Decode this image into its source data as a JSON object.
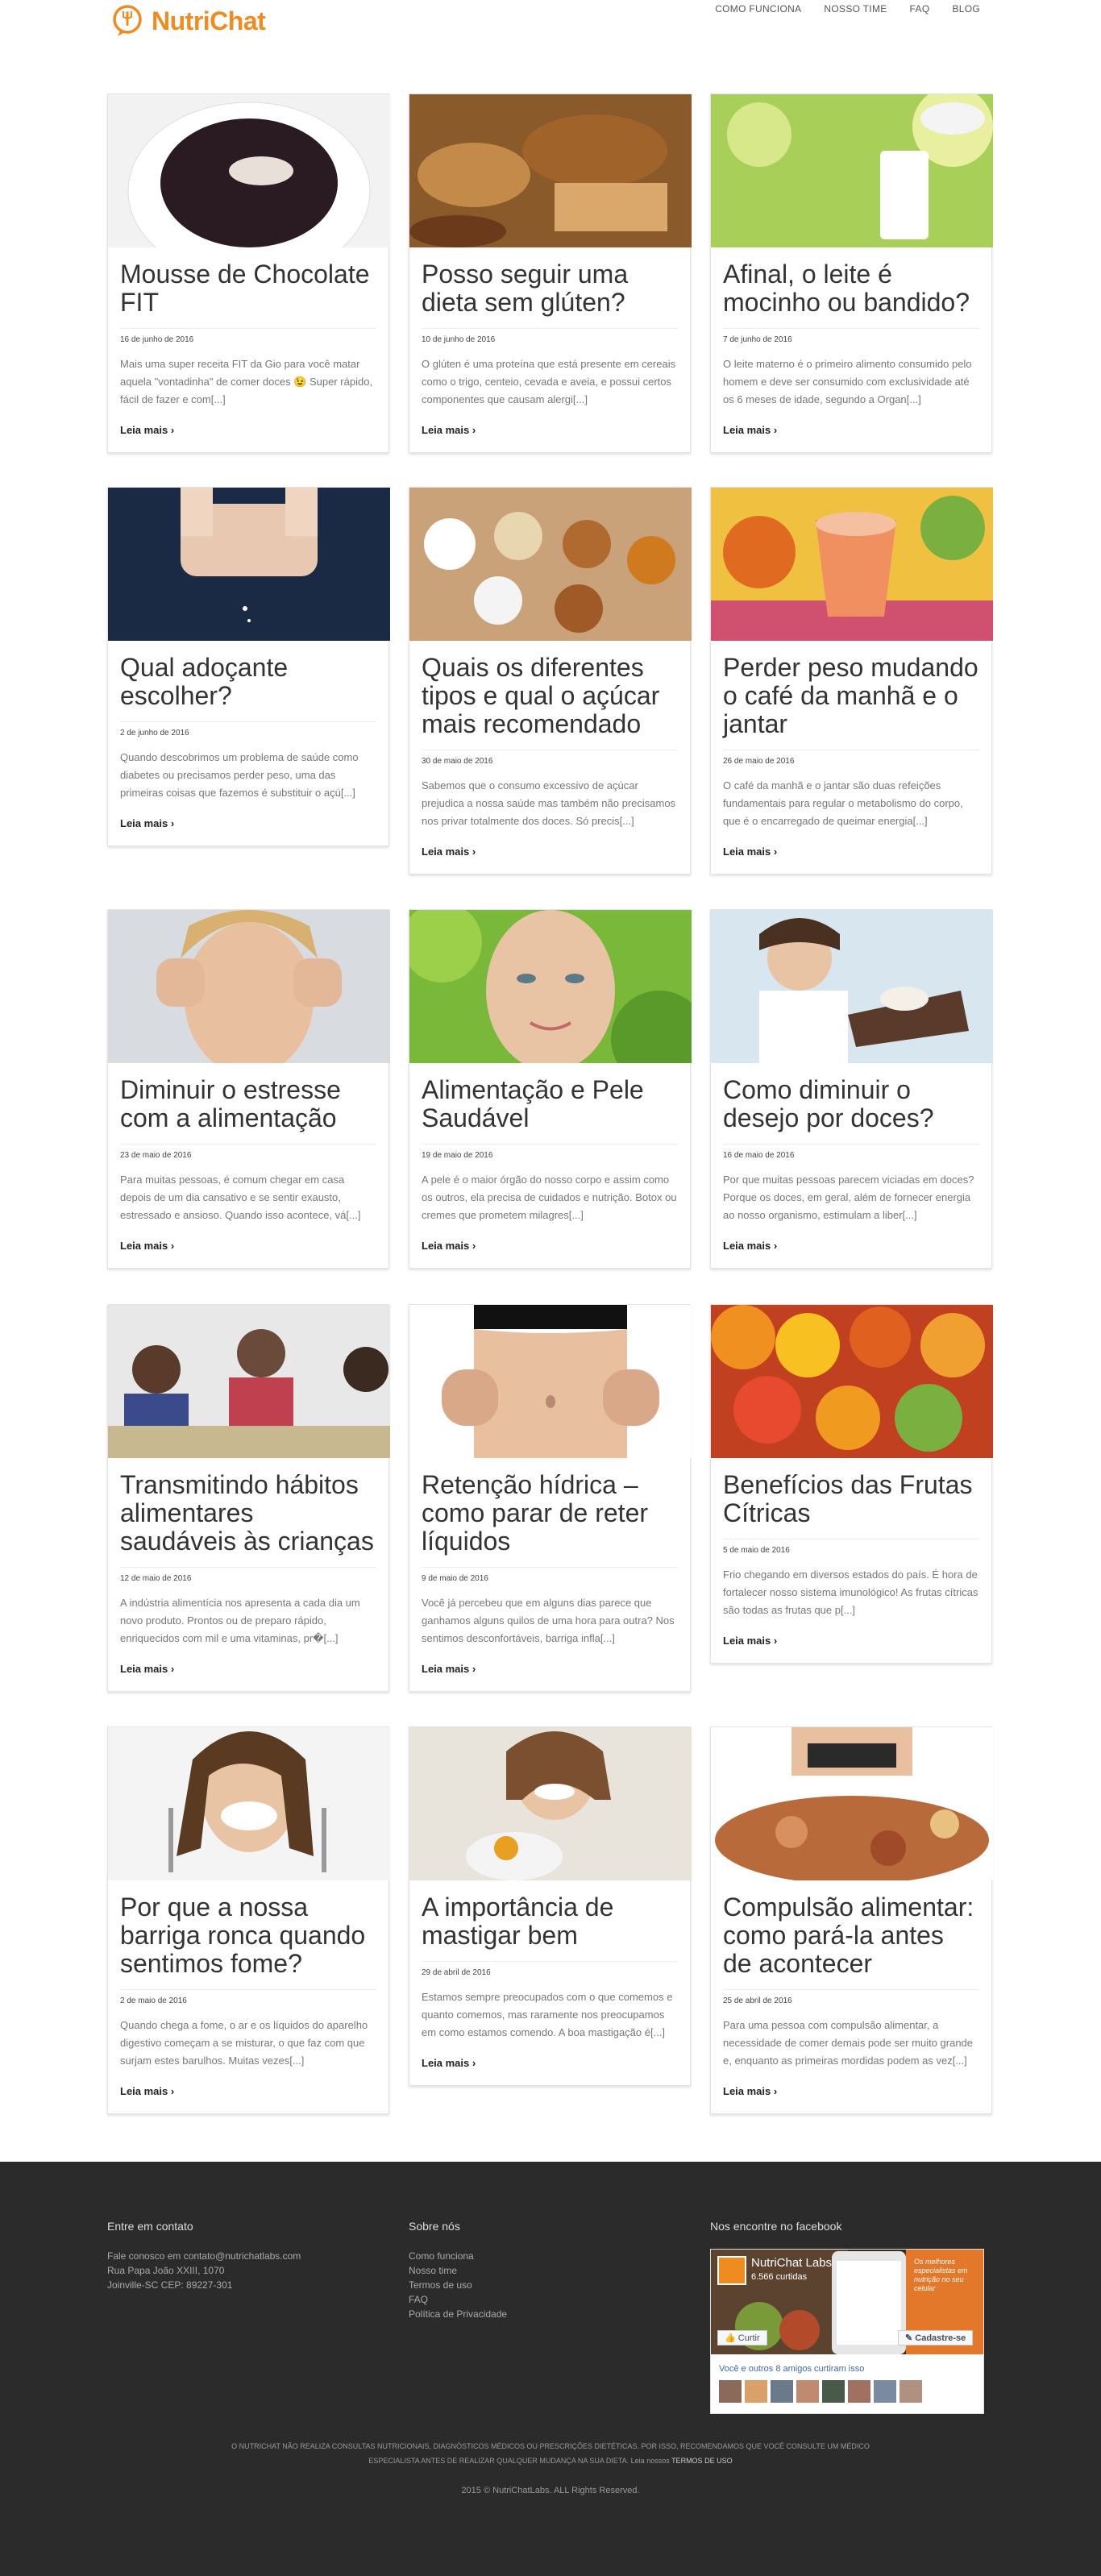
{
  "brand": {
    "name": "NutriChat",
    "accent": "#f08b1f"
  },
  "nav": [
    {
      "label": "COMO FUNCIONA"
    },
    {
      "label": "NOSSO TIME"
    },
    {
      "label": "FAQ"
    },
    {
      "label": "BLOG"
    }
  ],
  "posts": [
    {
      "title": "Mousse de Chocolate FIT",
      "date": "16 de junho de 2016",
      "excerpt": "Mais uma super receita FIT da Gio para você matar aquela \"vontadinha\" de comer doces 😉 Super rápido, fácil de fazer e com[...]",
      "more": "Leia mais"
    },
    {
      "title": "Posso seguir uma dieta sem glúten?",
      "date": "10 de junho de 2016",
      "excerpt": "O glúten é uma proteína que está presente em cereais como o trigo, centeio, cevada e aveia, e possui certos componentes que causam alergi[...]",
      "more": "Leia mais"
    },
    {
      "title": "Afinal, o leite é mocinho ou bandido?",
      "date": "7 de junho de 2016",
      "excerpt": "O leite materno é o primeiro alimento consumido pelo homem e deve ser consumido com exclusividade até os 6 meses de idade, segundo a Organ[...]",
      "more": "Leia mais"
    },
    {
      "title": "Qual adoçante escolher?",
      "date": "2 de junho de 2016",
      "excerpt": "Quando descobrimos um problema de saúde como diabetes ou precisamos perder peso, uma das primeiras coisas que fazemos é substituir o açú[...]",
      "more": "Leia mais"
    },
    {
      "title": "Quais os diferentes tipos e qual o açúcar mais recomendado",
      "date": "30 de maio de 2016",
      "excerpt": "Sabemos que o consumo excessivo de açúcar prejudica a nossa saúde mas também não precisamos nos privar totalmente dos doces. Só precis[...]",
      "more": "Leia mais"
    },
    {
      "title": "Perder peso mudando o café da manhã e o jantar",
      "date": "26 de maio de 2016",
      "excerpt": "O café da manhã e o jantar são duas refeições fundamentais para regular o metabolismo do corpo, que é o encarregado de queimar energia[...]",
      "more": "Leia mais"
    },
    {
      "title": "Diminuir o estresse com a alimentação",
      "date": "23 de maio de 2016",
      "excerpt": "Para muitas pessoas, é comum chegar em casa depois de um dia cansativo e se sentir exausto, estressado e ansioso. Quando isso acontece, vá[...]",
      "more": "Leia mais"
    },
    {
      "title": "Alimentação e Pele Saudável",
      "date": "19 de maio de 2016",
      "excerpt": "A pele é o maior órgão do nosso corpo e assim como os outros, ela precisa de cuidados e nutrição. Botox ou cremes que prometem milagres[...]",
      "more": "Leia mais"
    },
    {
      "title": "Como diminuir o desejo por doces?",
      "date": "16 de maio de 2016",
      "excerpt": "Por que muitas pessoas parecem viciadas em doces? Porque os doces, em geral, além de fornecer energia ao nosso organismo, estimulam a liber[...]",
      "more": "Leia mais"
    },
    {
      "title": "Transmitindo hábitos alimentares saudáveis às crianças",
      "date": "12 de maio de 2016",
      "excerpt": "A indústria alimentícia nos apresenta a cada dia um novo produto. Prontos ou de preparo rápido, enriquecidos com mil e uma vitaminas, pr�[...]",
      "more": "Leia mais"
    },
    {
      "title": "Retenção hídrica – como parar de reter líquidos",
      "date": "9 de maio de 2016",
      "excerpt": "Você já percebeu que em alguns dias parece que ganhamos alguns quilos de uma hora para outra? Nos sentimos desconfortáveis, barriga infla[...]",
      "more": "Leia mais"
    },
    {
      "title": "Benefícios das Frutas Cítricas",
      "date": "5 de maio de 2016",
      "excerpt": "Frio chegando em diversos estados do país. É hora de fortalecer nosso sistema imunológico! As frutas cítricas são todas as frutas que p[...]",
      "more": "Leia mais"
    },
    {
      "title": "Por que a nossa barriga ronca quando sentimos fome?",
      "date": "2 de maio de 2016",
      "excerpt": "Quando chega a fome, o ar e os líquidos do aparelho digestivo começam a se misturar, o que faz com que surjam estes barulhos. Muitas vezes[...]",
      "more": "Leia mais"
    },
    {
      "title": "A importância de mastigar bem",
      "date": "29 de abril de 2016",
      "excerpt": "Estamos sempre preocupados com o que comemos e quanto comemos, mas raramente nos preocupamos em como estamos comendo. A boa mastigação é[...]",
      "more": "Leia mais"
    },
    {
      "title": "Compulsão alimentar: como pará-la antes de acontecer",
      "date": "25 de abril de 2016",
      "excerpt": "Para uma pessoa com compulsão alimentar, a necessidade de comer demais pode ser muito grande e, enquanto as primeiras mordidas podem as vez[...]",
      "more": "Leia mais"
    }
  ],
  "footer": {
    "contact_title": "Entre em contato",
    "contact_lines": [
      "Fale conosco em contato@nutrichatlabs.com",
      "Rua Papa João XXIII, 1070",
      "Joinville-SC CEP: 89227-301"
    ],
    "about_title": "Sobre nós",
    "about_links": [
      "Como funciona",
      "Nosso time",
      "Termos de uso",
      "FAQ",
      "Política de Privacidade"
    ],
    "facebook_title": "Nos encontre no facebook",
    "fb_page_name": "NutriChat Labs",
    "fb_likes": "6.566 curtidas",
    "fb_like_btn": "Curtir",
    "fb_signup_btn": "Cadastre-se",
    "fb_tagline": "Os melhores especialistas em nutrição no seu celular",
    "fb_friends": "Você e outros 8 amigos curtiram isso",
    "disclaimer_line1": "O NUTRICHAT NÃO REALIZA CONSULTAS NUTRICIONAIS, DIAGNÓSTICOS MÉDICOS OU PRESCRIÇÕES DIETÉTICAS. POR ISSO, RECOMENDAMOS QUE VOCÊ CONSULTE UM MÉDICO",
    "disclaimer_line2": "ESPECIALISTA ANTES DE REALIZAR QUALQUER MUDANÇA NA SUA DIETA. Leia nossos",
    "disclaimer_link": "TERMOS DE USO",
    "copyright": "2015 © NutriChatLabs. ALL Rights Reserved."
  }
}
